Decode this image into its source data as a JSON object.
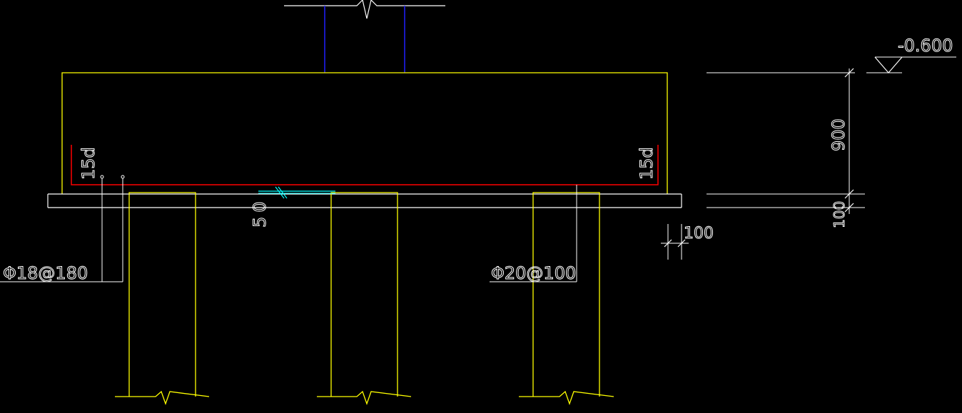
{
  "drawing": {
    "elevation_label": "-0.600",
    "dimensions": {
      "cap_thickness": "900",
      "cushion_thickness": "100",
      "cushion_extension": "100",
      "pile_embedment": "50"
    },
    "hook_labels": {
      "left": "15d",
      "right": "15d"
    },
    "rebar_labels": {
      "secondary": "Φ18@180",
      "main": "Φ20@100"
    },
    "colors": {
      "background": "#000000",
      "concrete_outline": "#ffff00",
      "rebar": "#ff0000",
      "column": "#0000ff",
      "cushion_top": "#8080ff",
      "annotation": "#ffffff",
      "break_symbol": "#00ffff"
    }
  }
}
